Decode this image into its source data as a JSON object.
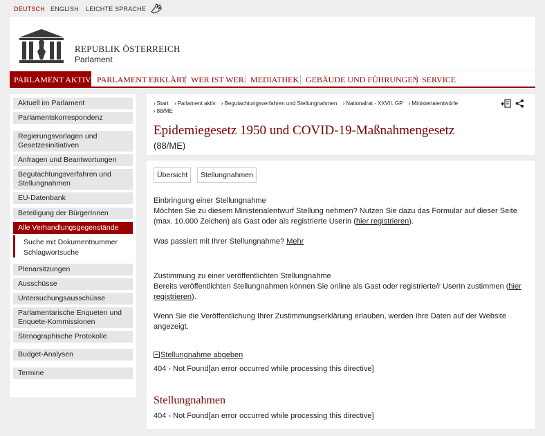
{
  "languages": [
    "DEUTSCH",
    "ENGLISH",
    "LEICHTE SPRACHE"
  ],
  "brand": {
    "line1": "REPUBLIK ÖSTERREICH",
    "line2": "Parlament"
  },
  "nav": [
    "PARLAMENT AKTIV",
    "PARLAMENT ERKLÄRT",
    "WER IST WER",
    "MEDIATHEK",
    "GEBÄUDE UND FÜHRUNGEN",
    "SERVICE"
  ],
  "sidebar": {
    "items": [
      "Aktuell im Parlament",
      "Parlamentskorrespondenz",
      "Regierungsvorlagen und Gesetzesinitiativen",
      "Anfragen und Beantwortungen",
      "Begutachtungsverfahren und Stellungnahmen",
      "EU-Datenbank",
      "Beteiligung der BürgerInnen",
      "Alle Verhandlungsgegenstände",
      "Plenarsitzungen",
      "Ausschüsse",
      "Untersuchungsausschüsse",
      "Parlamentarische Enqueten und Enquete-Kommissionen",
      "Stenographische Protokolle",
      "Budget-Analysen",
      "Termine"
    ],
    "subitems": [
      "Suche mit Dokumentnummer",
      "Schlagwortsuche"
    ]
  },
  "breadcrumb": [
    "Start",
    "Parlament aktiv",
    "Begutachtungsverfahren und Stellungnahmen",
    "Nationalrat - XXVII. GP",
    "Ministerialentwürfe",
    "88/ME"
  ],
  "page": {
    "title": "Epidemiegesetz 1950 und COVID-19-Maßnahmengesetz",
    "subtitle": "(88/ME)"
  },
  "tabs": [
    "Übersicht",
    "Stellungnahmen"
  ],
  "content": {
    "h1": "Einbringung einer Stellungnahme",
    "p1": "Möchten Sie zu diesem Ministerialentwurf Stellung nehmen? Nutzen Sie dazu das Formular auf dieser Seite (max. 10.000 Zeichen) als Gast oder als registrierte UserIn (",
    "link_register": "hier registrieren",
    "p1_end": ").",
    "p2": "Was passiert mit Ihrer Stellungnahme?",
    "link_more": "Mehr",
    "h2": "Zustimmung zu einer veröffentlichten Stellungnahme",
    "p3": "Bereits veröffentlichten Stellungnahmen können Sie online als Gast oder registrierte/r UserIn zustimmen (",
    "p3_end": ").",
    "p4": "Wenn Sie die Veröffentlichung Ihrer Zustimmungserklärung erlauben, werden Ihre Daten auf der Website angezeigt.",
    "submit_link": "Stellungnahme abgeben",
    "error1": "404 - Not Found[an error occurred while processing this directive]",
    "section_title": "Stellungnahmen",
    "error2": "404 - Not Found[an error occurred while processing this directive]"
  },
  "colors": {
    "accent": "#9b0000",
    "title": "#7a0000",
    "background": "#eeeeee"
  }
}
